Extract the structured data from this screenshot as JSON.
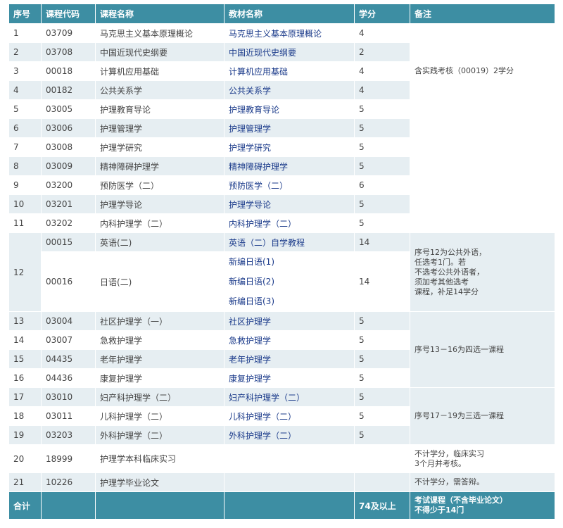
{
  "headers": [
    "序号",
    "课程代码",
    "课程名称",
    "教材名称",
    "学分",
    "备注"
  ],
  "rows": [
    {
      "no": "1",
      "code": "03709",
      "name": "马克思主义基本原理概论",
      "book": "马克思主义基本原理概论",
      "credit": "4"
    },
    {
      "no": "2",
      "code": "03708",
      "name": "中国近现代史纲要",
      "book": "中国近现代史纲要",
      "credit": "2"
    },
    {
      "no": "3",
      "code": "00018",
      "name": "计算机应用基础",
      "book": "计算机应用基础",
      "credit": "4"
    },
    {
      "no": "4",
      "code": "00182",
      "name": "公共关系学",
      "book": "公共关系学",
      "credit": "4"
    },
    {
      "no": "5",
      "code": "03005",
      "name": "护理教育导论",
      "book": "护理教育导论",
      "credit": "5"
    },
    {
      "no": "6",
      "code": "03006",
      "name": "护理管理学",
      "book": "护理管理学",
      "credit": "5"
    },
    {
      "no": "7",
      "code": "03008",
      "name": "护理学研究",
      "book": "护理学研究",
      "credit": "5"
    },
    {
      "no": "8",
      "code": "03009",
      "name": "精神障碍护理学",
      "book": "精神障碍护理学",
      "credit": "5"
    },
    {
      "no": "9",
      "code": "03200",
      "name": "预防医学（二）",
      "book": "预防医学（二）",
      "credit": "6"
    },
    {
      "no": "10",
      "code": "03201",
      "name": "护理学导论",
      "book": "护理学导论",
      "credit": "5"
    },
    {
      "no": "11",
      "code": "03202",
      "name": "内科护理学（二）",
      "book": "内科护理学（二）",
      "credit": "5"
    },
    {
      "no": "13",
      "code": "03004",
      "name": "社区护理学（一）",
      "book": "社区护理学",
      "credit": "5"
    },
    {
      "no": "14",
      "code": "03007",
      "name": "急救护理学",
      "book": "急救护理学",
      "credit": "5"
    },
    {
      "no": "15",
      "code": "04435",
      "name": "老年护理学",
      "book": "老年护理学",
      "credit": "5"
    },
    {
      "no": "16",
      "code": "04436",
      "name": "康复护理学",
      "book": "康复护理学",
      "credit": "5"
    },
    {
      "no": "17",
      "code": "03010",
      "name": "妇产科护理学（二）",
      "book": "妇产科护理学（二）",
      "credit": "5"
    },
    {
      "no": "18",
      "code": "03011",
      "name": "儿科护理学（二）",
      "book": "儿科护理学（二）",
      "credit": "5"
    },
    {
      "no": "19",
      "code": "03203",
      "name": "外科护理学（二）",
      "book": "外科护理学（二）",
      "credit": "5"
    },
    {
      "no": "20",
      "code": "18999",
      "name": "护理学本科临床实习",
      "book": "",
      "credit": ""
    },
    {
      "no": "21",
      "code": "10226",
      "name": "护理学毕业论文",
      "book": "",
      "credit": ""
    }
  ],
  "row12": {
    "no": "12",
    "english": {
      "code": "00015",
      "name": "英语(二)",
      "book": "英语（二）自学教程",
      "credit": "14"
    },
    "japanese": {
      "code": "00016",
      "name": "日语(二)",
      "books": [
        "新编日语(1)",
        "新编日语(2)",
        "新编日语(3)"
      ],
      "credit": "14"
    }
  },
  "notes": {
    "row3": "含实践考核（00019）2学分",
    "row12": [
      "序号12为公共外语，",
      "任选考1门。若",
      "不选考公共外语者，",
      "须加考其他选考",
      "课程，补足14学分"
    ],
    "rows13_16": "序号13－16为四选一课程",
    "rows17_19": "序号17－19为三选一课程",
    "row20": [
      "不计学分，临床实习",
      "3个月并考核。"
    ],
    "row21": "不计学分，需答辩。"
  },
  "footer": {
    "label": "合计",
    "credit": "74及以上",
    "note": [
      "考试课程（不含毕业论文）",
      "不得少于14门"
    ]
  }
}
